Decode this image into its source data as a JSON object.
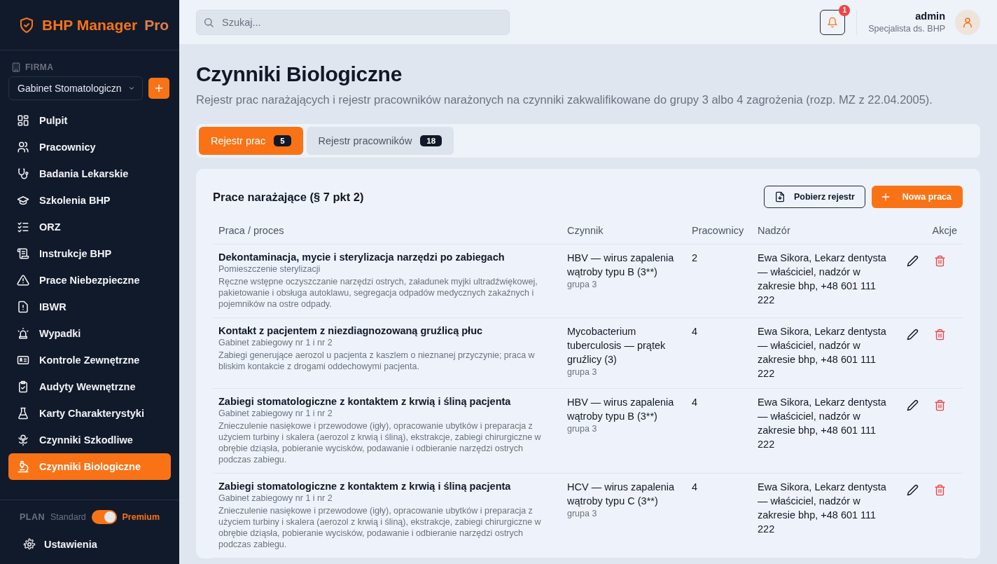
{
  "app": {
    "name": "BHP Manager",
    "badge": "Pro"
  },
  "company": {
    "label": "FIRMA",
    "value": "Gabinet Stomatologiczn"
  },
  "nav": [
    {
      "label": "Pulpit",
      "selected": false
    },
    {
      "label": "Pracownicy",
      "selected": false
    },
    {
      "label": "Badania Lekarskie",
      "selected": false
    },
    {
      "label": "Szkolenia BHP",
      "selected": false
    },
    {
      "label": "ORZ",
      "selected": false
    },
    {
      "label": "Instrukcje BHP",
      "selected": false
    },
    {
      "label": "Prace Niebezpieczne",
      "selected": false
    },
    {
      "label": "IBWR",
      "selected": false
    },
    {
      "label": "Wypadki",
      "selected": false
    },
    {
      "label": "Kontrole Zewnętrzne",
      "selected": false
    },
    {
      "label": "Audyty Wewnętrzne",
      "selected": false
    },
    {
      "label": "Karty Charakterystyki",
      "selected": false
    },
    {
      "label": "Czynniki Szkodliwe",
      "selected": false
    },
    {
      "label": "Czynniki Biologiczne",
      "selected": true
    }
  ],
  "plan": {
    "label": "PLAN",
    "off_label": "Standard",
    "on_label": "Premium",
    "on": true
  },
  "settings": "Ustawienia",
  "search": {
    "placeholder": "Szukaj..."
  },
  "notifications": {
    "count": "1"
  },
  "user": {
    "name": "admin",
    "role": "Specjalista ds. BHP"
  },
  "page": {
    "title": "Czynniki Biologiczne",
    "subtitle": "Rejestr prac narażających i rejestr pracowników narażonych na czynniki zakwalifikowane do grupy 3 albo 4 zagrożenia (rozp. MZ z 22.04.2005)."
  },
  "tabs": [
    {
      "label": "Rejestr prac",
      "count": "5",
      "selected": true
    },
    {
      "label": "Rejestr pracowników",
      "count": "18",
      "selected": false
    }
  ],
  "section": {
    "title": "Prace narażające (§ 7 pkt 2)",
    "download_button": "Pobierz rejestr",
    "add_button": "Nowa praca"
  },
  "table": {
    "columns": [
      "Praca / proces",
      "Czynnik",
      "Pracownicy",
      "Nadzór",
      "Akcje"
    ],
    "rows": [
      {
        "title": "Dekontaminacja, mycie i sterylizacja narzędzi po zabiegach",
        "location": "Pomieszczenie sterylizacji",
        "description": "Ręczne wstępne oczyszczanie narzędzi ostrych, załadunek myjki ultradźwiękowej, pakietowanie i obsługa autoklawu, segregacja odpadów medycznych zakaźnych i pojemników na ostre odpady.",
        "agent": "HBV — wirus zapalenia wątroby typu B (3**)",
        "group": "grupa 3",
        "workers": "2",
        "supervision": "Ewa Sikora, Lekarz dentysta — właściciel, nadzór w zakresie bhp, +48 601 111 222"
      },
      {
        "title": "Kontakt z pacjentem z niezdiagnozowaną gruźlicą płuc",
        "location": "Gabinet zabiegowy nr 1 i nr 2",
        "description": "Zabiegi generujące aerozol u pacjenta z kaszlem o nieznanej przyczynie; praca w bliskim kontakcie z drogami oddechowymi pacjenta.",
        "agent": "Mycobacterium tuberculosis — prątek gruźlicy (3)",
        "group": "grupa 3",
        "workers": "4",
        "supervision": "Ewa Sikora, Lekarz dentysta — właściciel, nadzór w zakresie bhp, +48 601 111 222"
      },
      {
        "title": "Zabiegi stomatologiczne z kontaktem z krwią i śliną pacjenta",
        "location": "Gabinet zabiegowy nr 1 i nr 2",
        "description": "Znieczulenie nasiękowe i przewodowe (igły), opracowanie ubytków i preparacja z użyciem turbiny i skalera (aerozol z krwią i śliną), ekstrakcje, zabiegi chirurgiczne w obrębie dziąsła, pobieranie wycisków, podawanie i odbieranie narzędzi ostrych podczas zabiegu.",
        "agent": "HBV — wirus zapalenia wątroby typu B (3**)",
        "group": "grupa 3",
        "workers": "4",
        "supervision": "Ewa Sikora, Lekarz dentysta — właściciel, nadzór w zakresie bhp, +48 601 111 222"
      },
      {
        "title": "Zabiegi stomatologiczne z kontaktem z krwią i śliną pacjenta",
        "location": "Gabinet zabiegowy nr 1 i nr 2",
        "description": "Znieczulenie nasiękowe i przewodowe (igły), opracowanie ubytków i preparacja z użyciem turbiny i skalera (aerozol z krwią i śliną), ekstrakcje, zabiegi chirurgiczne w obrębie dziąsła, pobieranie wycisków, podawanie i odbieranie narzędzi ostrych podczas zabiegu.",
        "agent": "HCV — wirus zapalenia wątroby typu C (3**)",
        "group": "grupa 3",
        "workers": "4",
        "supervision": "Ewa Sikora, Lekarz dentysta — właściciel, nadzór w zakresie bhp, +48 601 111 222"
      }
    ]
  }
}
